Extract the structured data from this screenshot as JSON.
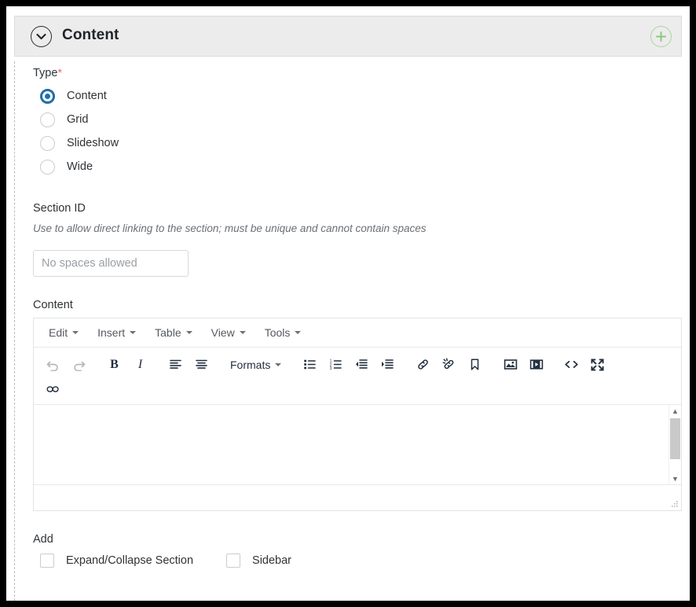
{
  "panel": {
    "title": "Content",
    "collapse_icon": "chevron-down-icon",
    "add_icon": "plus-circle-icon",
    "add_color": "#8bc680",
    "accent_color": "#1f6eaa"
  },
  "type_field": {
    "label": "Type",
    "required_marker": "*",
    "options": [
      {
        "label": "Content",
        "selected": true
      },
      {
        "label": "Grid",
        "selected": false
      },
      {
        "label": "Slideshow",
        "selected": false
      },
      {
        "label": "Wide",
        "selected": false
      }
    ]
  },
  "section_id": {
    "label": "Section ID",
    "hint": "Use to allow direct linking to the section; must be unique and cannot contain spaces",
    "value": "",
    "placeholder": "No spaces allowed"
  },
  "content": {
    "label": "Content",
    "editor": {
      "menubar": [
        {
          "label": "Edit"
        },
        {
          "label": "Insert"
        },
        {
          "label": "Table"
        },
        {
          "label": "View"
        },
        {
          "label": "Tools"
        }
      ],
      "toolbar_row1": [
        {
          "name": "undo-icon",
          "label": "Undo",
          "disabled": true
        },
        {
          "name": "redo-icon",
          "label": "Redo",
          "disabled": true
        },
        {
          "name": "bold-icon",
          "label": "B"
        },
        {
          "name": "italic-icon",
          "label": "I"
        },
        {
          "name": "align-left-icon",
          "label": "Align left"
        },
        {
          "name": "align-center-icon",
          "label": "Align center"
        },
        {
          "name": "formats-menu",
          "label": "Formats"
        },
        {
          "name": "bullet-list-icon",
          "label": "Bullet list"
        },
        {
          "name": "numbered-list-icon",
          "label": "Numbered list"
        },
        {
          "name": "outdent-icon",
          "label": "Decrease indent"
        },
        {
          "name": "indent-icon",
          "label": "Increase indent"
        },
        {
          "name": "link-icon",
          "label": "Insert/edit link"
        },
        {
          "name": "unlink-icon",
          "label": "Remove link"
        },
        {
          "name": "anchor-icon",
          "label": "Anchor"
        },
        {
          "name": "image-icon",
          "label": "Insert/edit image"
        },
        {
          "name": "media-icon",
          "label": "Insert/edit media"
        },
        {
          "name": "source-code-icon",
          "label": "Source code"
        },
        {
          "name": "fullscreen-icon",
          "label": "Fullscreen"
        }
      ],
      "toolbar_row2": [
        {
          "name": "special-character-icon",
          "label": "Special character"
        }
      ],
      "body_text": "",
      "status_text": ""
    }
  },
  "add_field": {
    "label": "Add",
    "options": [
      {
        "label": "Expand/Collapse Section",
        "checked": false
      },
      {
        "label": "Sidebar",
        "checked": false
      }
    ]
  }
}
